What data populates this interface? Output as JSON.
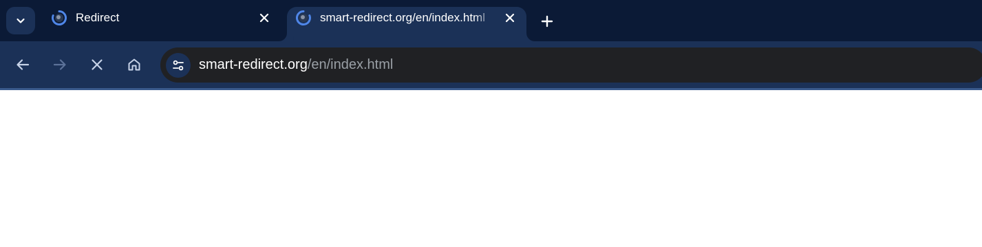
{
  "tabs": [
    {
      "title": "Redirect",
      "icon": "loading-spinner-icon",
      "active": false
    },
    {
      "title": "smart-redirect.org/en/index.html",
      "icon": "loading-spinner-icon",
      "active": true
    }
  ],
  "toolbar": {
    "back_icon": "back-arrow-icon",
    "forward_icon": "forward-arrow-icon",
    "stop_icon": "stop-icon",
    "home_icon": "home-icon"
  },
  "omnibox": {
    "host": "smart-redirect.org",
    "path": "/en/index.html",
    "site_info_icon": "tune-icon"
  },
  "colors": {
    "tabstrip_bg": "#0b1a36",
    "toolbar_bg": "#1b3157",
    "omnibox_bg": "#202124",
    "accent": "#8ab4f8"
  }
}
